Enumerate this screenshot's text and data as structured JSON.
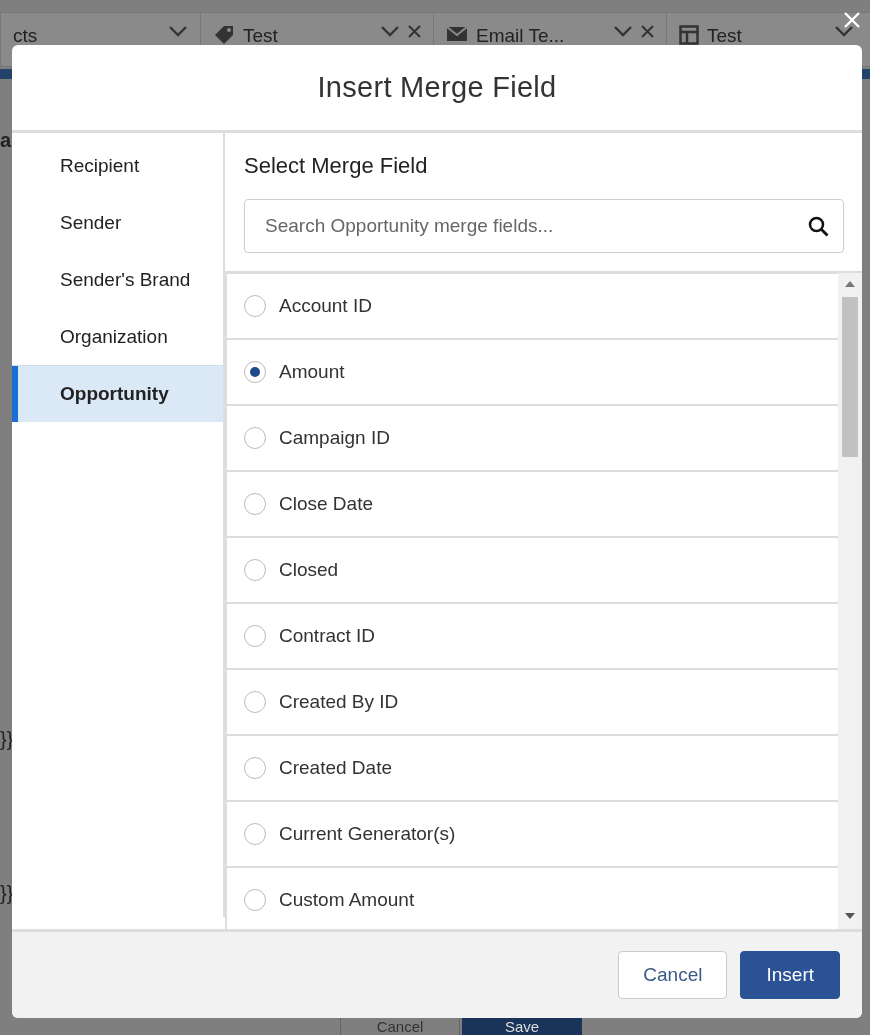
{
  "background": {
    "tabs": [
      {
        "label": "cts",
        "closable": false
      },
      {
        "label": "Test",
        "closable": true
      },
      {
        "label": "Email Te...",
        "closable": true
      },
      {
        "label": "Test",
        "closable": false
      }
    ],
    "side_texts": [
      "a",
      "}}",
      "}}"
    ],
    "buttons": [
      {
        "label": "Cancel",
        "kind": "neutral"
      },
      {
        "label": "Save",
        "kind": "brand"
      }
    ]
  },
  "modal": {
    "title": "Insert Merge Field",
    "nav": [
      {
        "label": "Recipient",
        "selected": false
      },
      {
        "label": "Sender",
        "selected": false
      },
      {
        "label": "Sender's Brand",
        "selected": false
      },
      {
        "label": "Organization",
        "selected": false
      },
      {
        "label": "Opportunity",
        "selected": true
      }
    ],
    "heading": "Select Merge Field",
    "search": {
      "placeholder": "Search Opportunity merge fields..."
    },
    "fields": [
      {
        "label": "Account ID",
        "selected": false
      },
      {
        "label": "Amount",
        "selected": true
      },
      {
        "label": "Campaign ID",
        "selected": false
      },
      {
        "label": "Close Date",
        "selected": false
      },
      {
        "label": "Closed",
        "selected": false
      },
      {
        "label": "Contract ID",
        "selected": false
      },
      {
        "label": "Created By ID",
        "selected": false
      },
      {
        "label": "Created Date",
        "selected": false
      },
      {
        "label": "Current Generator(s)",
        "selected": false
      },
      {
        "label": "Custom Amount",
        "selected": false
      }
    ],
    "buttons": [
      {
        "label": "Cancel",
        "kind": "neutral"
      },
      {
        "label": "Insert",
        "kind": "brand"
      }
    ]
  }
}
